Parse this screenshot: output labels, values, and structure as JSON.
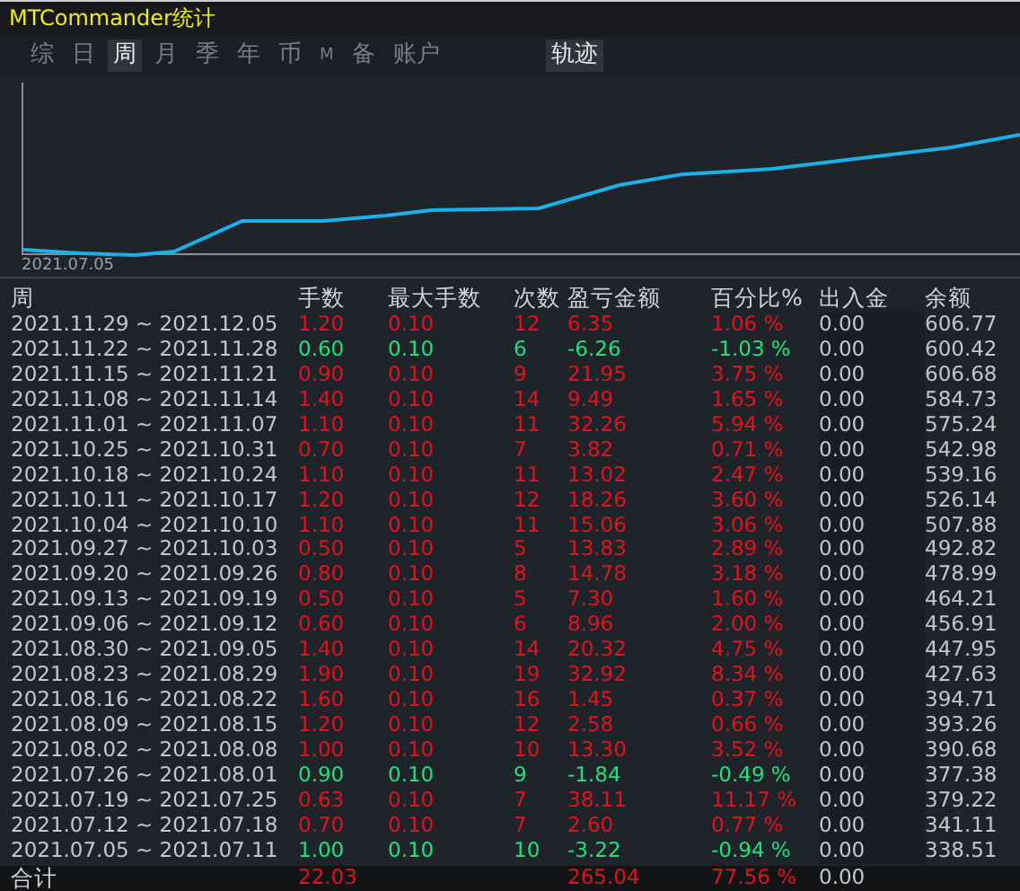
{
  "window": {
    "title": "MTCommander统计"
  },
  "tabs": [
    {
      "label": "综",
      "selected": false
    },
    {
      "label": "日",
      "selected": false
    },
    {
      "label": "周",
      "selected": true
    },
    {
      "label": "月",
      "selected": false
    },
    {
      "label": "季",
      "selected": false
    },
    {
      "label": "年",
      "selected": false
    },
    {
      "label": "币",
      "selected": false
    },
    {
      "label": "M",
      "selected": false
    },
    {
      "label": "备",
      "selected": false
    },
    {
      "label": "账户",
      "selected": false
    }
  ],
  "track_button": "轨迹",
  "chart": {
    "start_label": "2021.07.05"
  },
  "table": {
    "columns": [
      "周",
      "手数",
      "最大手数",
      "次数",
      "盈亏金额",
      "百分比%",
      "出入金",
      "余额"
    ],
    "rows": [
      {
        "cells": [
          "2021.11.29 ~ 2021.12.05",
          "1.20",
          "0.10",
          "12",
          "6.35",
          "1.06 %",
          "0.00",
          "606.77"
        ],
        "up": true
      },
      {
        "cells": [
          "2021.11.22 ~ 2021.11.28",
          "0.60",
          "0.10",
          "6",
          "-6.26",
          "-1.03 %",
          "0.00",
          "600.42"
        ],
        "up": false
      },
      {
        "cells": [
          "2021.11.15 ~ 2021.11.21",
          "0.90",
          "0.10",
          "9",
          "21.95",
          "3.75 %",
          "0.00",
          "606.68"
        ],
        "up": true
      },
      {
        "cells": [
          "2021.11.08 ~ 2021.11.14",
          "1.40",
          "0.10",
          "14",
          "9.49",
          "1.65 %",
          "0.00",
          "584.73"
        ],
        "up": true
      },
      {
        "cells": [
          "2021.11.01 ~ 2021.11.07",
          "1.10",
          "0.10",
          "11",
          "32.26",
          "5.94 %",
          "0.00",
          "575.24"
        ],
        "up": true
      },
      {
        "cells": [
          "2021.10.25 ~ 2021.10.31",
          "0.70",
          "0.10",
          "7",
          "3.82",
          "0.71 %",
          "0.00",
          "542.98"
        ],
        "up": true
      },
      {
        "cells": [
          "2021.10.18 ~ 2021.10.24",
          "1.10",
          "0.10",
          "11",
          "13.02",
          "2.47 %",
          "0.00",
          "539.16"
        ],
        "up": true
      },
      {
        "cells": [
          "2021.10.11 ~ 2021.10.17",
          "1.20",
          "0.10",
          "12",
          "18.26",
          "3.60 %",
          "0.00",
          "526.14"
        ],
        "up": true
      },
      {
        "cells": [
          "2021.10.04 ~ 2021.10.10",
          "1.10",
          "0.10",
          "11",
          "15.06",
          "3.06 %",
          "0.00",
          "507.88"
        ],
        "up": true
      },
      {
        "cells": [
          "2021.09.27 ~ 2021.10.03",
          "0.50",
          "0.10",
          "5",
          "13.83",
          "2.89 %",
          "0.00",
          "492.82"
        ],
        "up": true
      },
      {
        "cells": [
          "2021.09.20 ~ 2021.09.26",
          "0.80",
          "0.10",
          "8",
          "14.78",
          "3.18 %",
          "0.00",
          "478.99"
        ],
        "up": true
      },
      {
        "cells": [
          "2021.09.13 ~ 2021.09.19",
          "0.50",
          "0.10",
          "5",
          "7.30",
          "1.60 %",
          "0.00",
          "464.21"
        ],
        "up": true
      },
      {
        "cells": [
          "2021.09.06 ~ 2021.09.12",
          "0.60",
          "0.10",
          "6",
          "8.96",
          "2.00 %",
          "0.00",
          "456.91"
        ],
        "up": true
      },
      {
        "cells": [
          "2021.08.30 ~ 2021.09.05",
          "1.40",
          "0.10",
          "14",
          "20.32",
          "4.75 %",
          "0.00",
          "447.95"
        ],
        "up": true
      },
      {
        "cells": [
          "2021.08.23 ~ 2021.08.29",
          "1.90",
          "0.10",
          "19",
          "32.92",
          "8.34 %",
          "0.00",
          "427.63"
        ],
        "up": true
      },
      {
        "cells": [
          "2021.08.16 ~ 2021.08.22",
          "1.60",
          "0.10",
          "16",
          "1.45",
          "0.37 %",
          "0.00",
          "394.71"
        ],
        "up": true
      },
      {
        "cells": [
          "2021.08.09 ~ 2021.08.15",
          "1.20",
          "0.10",
          "12",
          "2.58",
          "0.66 %",
          "0.00",
          "393.26"
        ],
        "up": true
      },
      {
        "cells": [
          "2021.08.02 ~ 2021.08.08",
          "1.00",
          "0.10",
          "10",
          "13.30",
          "3.52 %",
          "0.00",
          "390.68"
        ],
        "up": true
      },
      {
        "cells": [
          "2021.07.26 ~ 2021.08.01",
          "0.90",
          "0.10",
          "9",
          "-1.84",
          "-0.49 %",
          "0.00",
          "377.38"
        ],
        "up": false
      },
      {
        "cells": [
          "2021.07.19 ~ 2021.07.25",
          "0.63",
          "0.10",
          "7",
          "38.11",
          "11.17 %",
          "0.00",
          "379.22"
        ],
        "up": true
      },
      {
        "cells": [
          "2021.07.12 ~ 2021.07.18",
          "0.70",
          "0.10",
          "7",
          "2.60",
          "0.77 %",
          "0.00",
          "341.11"
        ],
        "up": true
      },
      {
        "cells": [
          "2021.07.05 ~ 2021.07.11",
          "1.00",
          "0.10",
          "10",
          "-3.22",
          "-0.94 %",
          "0.00",
          "338.51"
        ],
        "up": false
      }
    ],
    "total": {
      "label": "合计",
      "lots": "22.03",
      "profit": "265.04",
      "percent": "77.56 %",
      "deposit": "0.00",
      "up": true
    }
  }
}
